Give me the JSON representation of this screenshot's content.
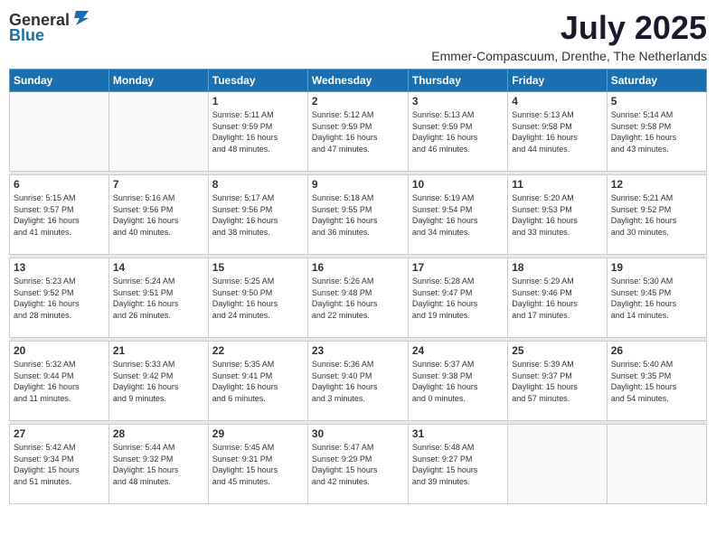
{
  "logo": {
    "general": "General",
    "blue": "Blue"
  },
  "title": "July 2025",
  "location": "Emmer-Compascuum, Drenthe, The Netherlands",
  "days_of_week": [
    "Sunday",
    "Monday",
    "Tuesday",
    "Wednesday",
    "Thursday",
    "Friday",
    "Saturday"
  ],
  "weeks": [
    [
      {
        "day": "",
        "info": ""
      },
      {
        "day": "",
        "info": ""
      },
      {
        "day": "1",
        "info": "Sunrise: 5:11 AM\nSunset: 9:59 PM\nDaylight: 16 hours\nand 48 minutes."
      },
      {
        "day": "2",
        "info": "Sunrise: 5:12 AM\nSunset: 9:59 PM\nDaylight: 16 hours\nand 47 minutes."
      },
      {
        "day": "3",
        "info": "Sunrise: 5:13 AM\nSunset: 9:59 PM\nDaylight: 16 hours\nand 46 minutes."
      },
      {
        "day": "4",
        "info": "Sunrise: 5:13 AM\nSunset: 9:58 PM\nDaylight: 16 hours\nand 44 minutes."
      },
      {
        "day": "5",
        "info": "Sunrise: 5:14 AM\nSunset: 9:58 PM\nDaylight: 16 hours\nand 43 minutes."
      }
    ],
    [
      {
        "day": "6",
        "info": "Sunrise: 5:15 AM\nSunset: 9:57 PM\nDaylight: 16 hours\nand 41 minutes."
      },
      {
        "day": "7",
        "info": "Sunrise: 5:16 AM\nSunset: 9:56 PM\nDaylight: 16 hours\nand 40 minutes."
      },
      {
        "day": "8",
        "info": "Sunrise: 5:17 AM\nSunset: 9:56 PM\nDaylight: 16 hours\nand 38 minutes."
      },
      {
        "day": "9",
        "info": "Sunrise: 5:18 AM\nSunset: 9:55 PM\nDaylight: 16 hours\nand 36 minutes."
      },
      {
        "day": "10",
        "info": "Sunrise: 5:19 AM\nSunset: 9:54 PM\nDaylight: 16 hours\nand 34 minutes."
      },
      {
        "day": "11",
        "info": "Sunrise: 5:20 AM\nSunset: 9:53 PM\nDaylight: 16 hours\nand 33 minutes."
      },
      {
        "day": "12",
        "info": "Sunrise: 5:21 AM\nSunset: 9:52 PM\nDaylight: 16 hours\nand 30 minutes."
      }
    ],
    [
      {
        "day": "13",
        "info": "Sunrise: 5:23 AM\nSunset: 9:52 PM\nDaylight: 16 hours\nand 28 minutes."
      },
      {
        "day": "14",
        "info": "Sunrise: 5:24 AM\nSunset: 9:51 PM\nDaylight: 16 hours\nand 26 minutes."
      },
      {
        "day": "15",
        "info": "Sunrise: 5:25 AM\nSunset: 9:50 PM\nDaylight: 16 hours\nand 24 minutes."
      },
      {
        "day": "16",
        "info": "Sunrise: 5:26 AM\nSunset: 9:48 PM\nDaylight: 16 hours\nand 22 minutes."
      },
      {
        "day": "17",
        "info": "Sunrise: 5:28 AM\nSunset: 9:47 PM\nDaylight: 16 hours\nand 19 minutes."
      },
      {
        "day": "18",
        "info": "Sunrise: 5:29 AM\nSunset: 9:46 PM\nDaylight: 16 hours\nand 17 minutes."
      },
      {
        "day": "19",
        "info": "Sunrise: 5:30 AM\nSunset: 9:45 PM\nDaylight: 16 hours\nand 14 minutes."
      }
    ],
    [
      {
        "day": "20",
        "info": "Sunrise: 5:32 AM\nSunset: 9:44 PM\nDaylight: 16 hours\nand 11 minutes."
      },
      {
        "day": "21",
        "info": "Sunrise: 5:33 AM\nSunset: 9:42 PM\nDaylight: 16 hours\nand 9 minutes."
      },
      {
        "day": "22",
        "info": "Sunrise: 5:35 AM\nSunset: 9:41 PM\nDaylight: 16 hours\nand 6 minutes."
      },
      {
        "day": "23",
        "info": "Sunrise: 5:36 AM\nSunset: 9:40 PM\nDaylight: 16 hours\nand 3 minutes."
      },
      {
        "day": "24",
        "info": "Sunrise: 5:37 AM\nSunset: 9:38 PM\nDaylight: 16 hours\nand 0 minutes."
      },
      {
        "day": "25",
        "info": "Sunrise: 5:39 AM\nSunset: 9:37 PM\nDaylight: 15 hours\nand 57 minutes."
      },
      {
        "day": "26",
        "info": "Sunrise: 5:40 AM\nSunset: 9:35 PM\nDaylight: 15 hours\nand 54 minutes."
      }
    ],
    [
      {
        "day": "27",
        "info": "Sunrise: 5:42 AM\nSunset: 9:34 PM\nDaylight: 15 hours\nand 51 minutes."
      },
      {
        "day": "28",
        "info": "Sunrise: 5:44 AM\nSunset: 9:32 PM\nDaylight: 15 hours\nand 48 minutes."
      },
      {
        "day": "29",
        "info": "Sunrise: 5:45 AM\nSunset: 9:31 PM\nDaylight: 15 hours\nand 45 minutes."
      },
      {
        "day": "30",
        "info": "Sunrise: 5:47 AM\nSunset: 9:29 PM\nDaylight: 15 hours\nand 42 minutes."
      },
      {
        "day": "31",
        "info": "Sunrise: 5:48 AM\nSunset: 9:27 PM\nDaylight: 15 hours\nand 39 minutes."
      },
      {
        "day": "",
        "info": ""
      },
      {
        "day": "",
        "info": ""
      }
    ]
  ]
}
